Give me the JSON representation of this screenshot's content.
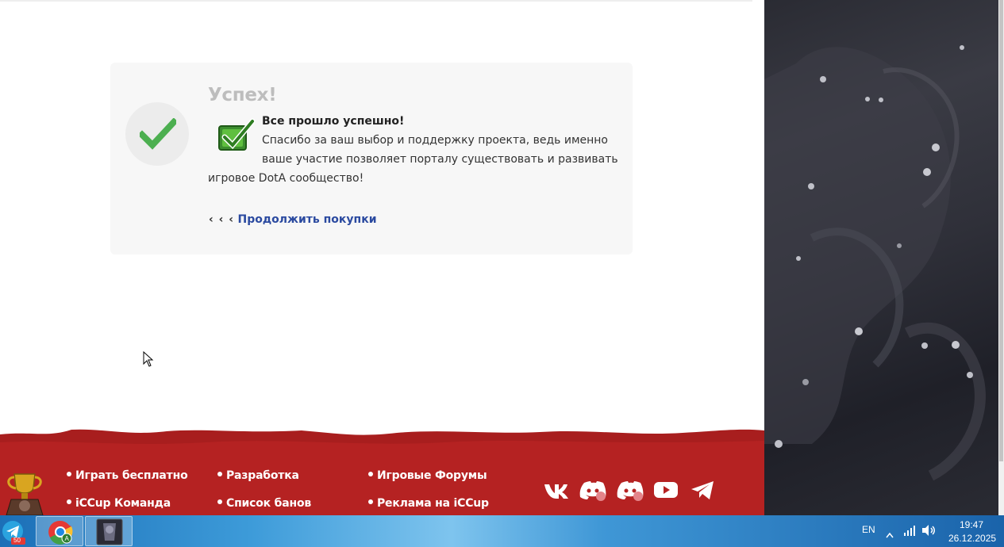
{
  "success": {
    "title": "Успех!",
    "headline": "Все прошло успешно!",
    "line1": "Спасибо за ваш выбор и поддержку проекта, ведь именно",
    "line2": "ваше участие позволяет порталу существовать и развивать",
    "line3": "игровое DotA сообщество!",
    "continue_prefix": "‹ ‹ ‹",
    "continue_label": "Продолжить покупки"
  },
  "footer": {
    "col1": [
      "Играть бесплатно",
      "iCCup Команда"
    ],
    "col2": [
      "Разработка",
      "Список банов"
    ],
    "col3": [
      "Игровые Форумы",
      "Реклама на iCCup"
    ],
    "socials": [
      "vk-icon",
      "discord-icon",
      "discord-icon",
      "youtube-icon",
      "telegram-icon"
    ]
  },
  "taskbar": {
    "apps": [
      "telegram-icon",
      "chrome-icon",
      "game-icon"
    ],
    "telegram_badge": "50",
    "language": "EN",
    "time": "19:47",
    "date": "26.12.2025"
  },
  "colors": {
    "accent_link": "#2b4aa0",
    "check_green": "#4caf50",
    "footer_red": "#a81e1e",
    "taskbar_blue": "#1c6fb7"
  }
}
